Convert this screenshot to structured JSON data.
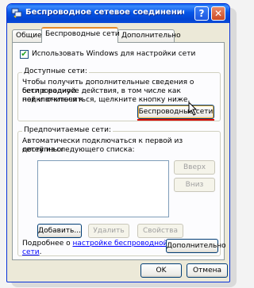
{
  "window": {
    "title": "Беспроводное сетевое соединение - свой...",
    "help_label": "?",
    "close_label": "✕"
  },
  "tabs": [
    {
      "label": "Общие"
    },
    {
      "label": "Беспроводные сети"
    },
    {
      "label": "Дополнительно"
    }
  ],
  "use_windows": {
    "label": "Использовать Windows для настройки сети",
    "checked": true,
    "mark": "✔"
  },
  "available": {
    "title": "Доступные сети:",
    "line1": "Чтобы получить дополнительные сведения о беспроводной",
    "line2": "сети в радиусе действия, в том числе как подключиться к",
    "line3": "ней и отключиться, щелкните кнопку ниже.",
    "button": "Беспроводные сети"
  },
  "preferred": {
    "title": "Предпочитаемые сети:",
    "line1": "Автоматически подключаться к первой из доступных",
    "line2": "сетей из следующего списка:",
    "up": "Вверх",
    "down": "Вниз",
    "add": "Добавить...",
    "remove": "Удалить",
    "properties": "Свойства",
    "more_prefix": "Подробнее о",
    "more_link1": "настройке беспроводной",
    "more_link2": "сети",
    "more_suffix": ".",
    "advanced": "Дополнительно"
  },
  "footer": {
    "ok": "OK",
    "cancel": "Отмена"
  },
  "colors": {
    "titlebar": "#0a5fe8",
    "accent_tab": "#e68b2c",
    "annotation": "#dd0000"
  }
}
